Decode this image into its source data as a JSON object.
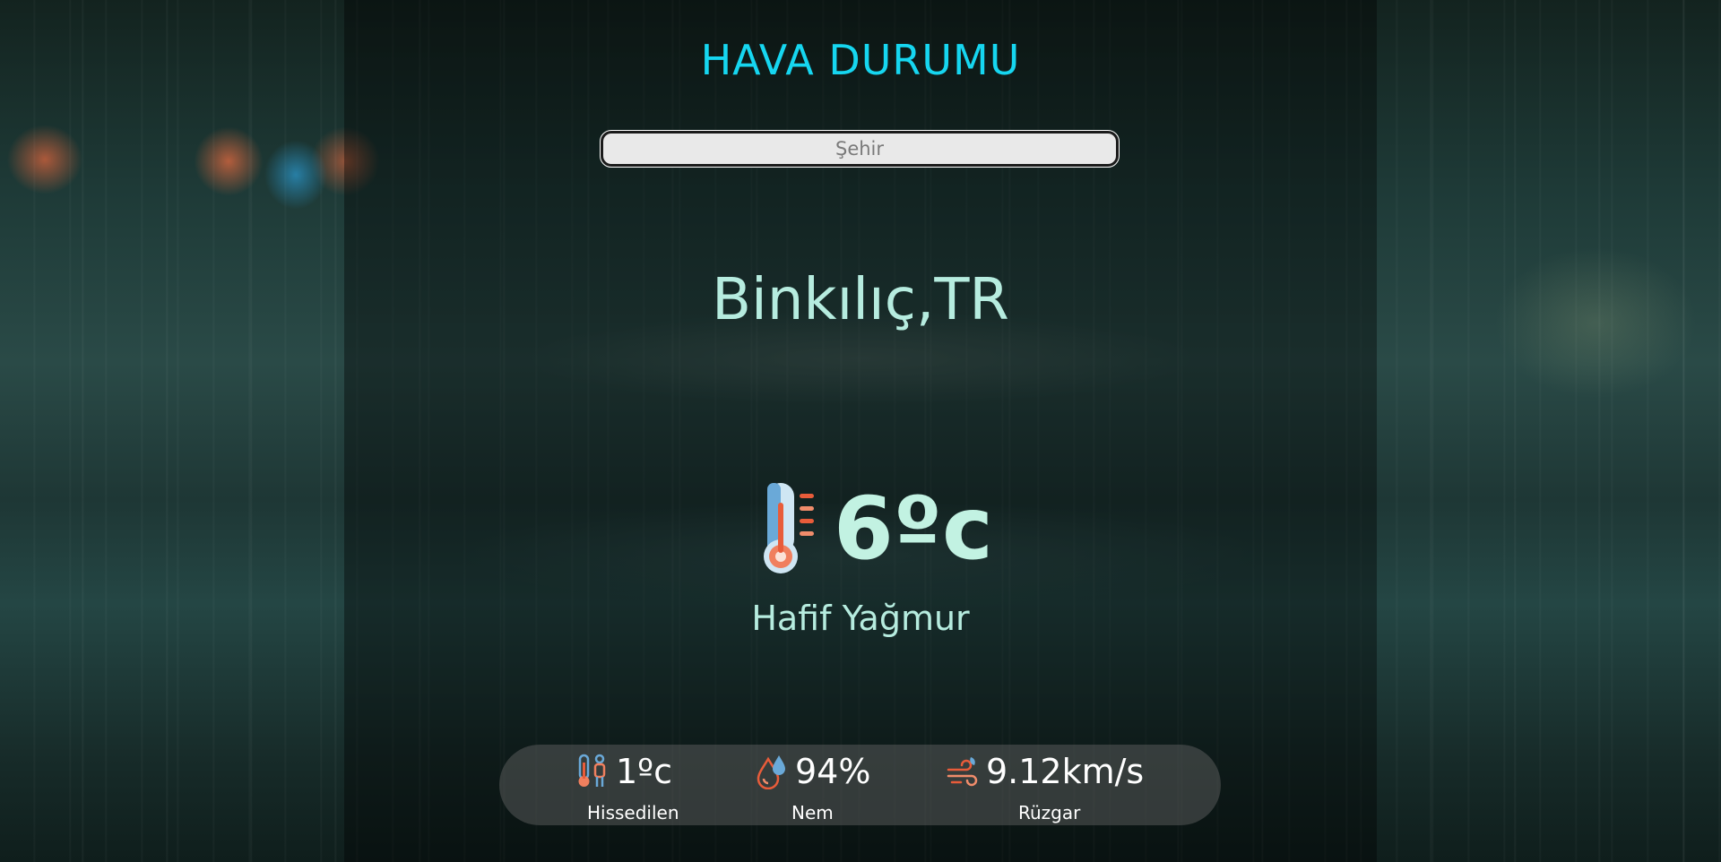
{
  "app": {
    "title": "HAVA DURUMU"
  },
  "search": {
    "placeholder": "Şehir"
  },
  "weather": {
    "city": "Binkılıç,TR",
    "temperature": "6ºc",
    "description": "Hafif Yağmur",
    "icon": "thermometer-icon"
  },
  "details": {
    "feels_like": {
      "value": "1ºc",
      "label": "Hissedilen",
      "icon": "feels-like-icon"
    },
    "humidity": {
      "value": "94%",
      "label": "Nem",
      "icon": "humidity-icon"
    },
    "wind": {
      "value": "9.12km/s",
      "label": "Rüzgar",
      "icon": "wind-icon"
    }
  },
  "colors": {
    "title": "#16d6f0",
    "text": "#b6ecdf",
    "info_text": "#ffffff"
  }
}
